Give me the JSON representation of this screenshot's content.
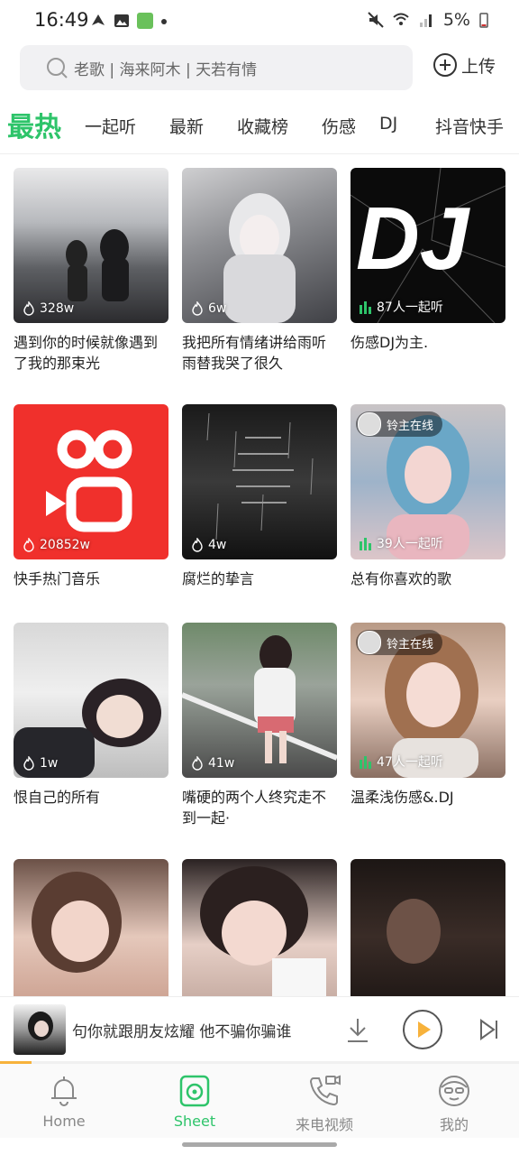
{
  "status_bar": {
    "time": "16:49",
    "battery": "5%"
  },
  "search": {
    "placeholder_text": "老歌 | 海来阿木 | 天若有情"
  },
  "upload": {
    "label": "上传"
  },
  "tabs": [
    {
      "label": "最热",
      "active": true
    },
    {
      "label": "一起听"
    },
    {
      "label": "最新"
    },
    {
      "label": "收藏榜"
    },
    {
      "label": "伤感"
    },
    {
      "label": "DJ"
    },
    {
      "label": "抖音快手"
    }
  ],
  "cards": [
    {
      "title": "遇到你的时候就像遇到了我的那束光",
      "count": "328w"
    },
    {
      "title": "我把所有情绪讲给雨听 雨替我哭了很久",
      "count": "6w"
    },
    {
      "title": "伤感DJ为主.",
      "count": "87人一起听",
      "dj_text": "DJ"
    },
    {
      "title": "快手热门音乐",
      "count": "20852w"
    },
    {
      "title": "腐烂的挚言",
      "count": "4w"
    },
    {
      "title": "总有你喜欢的歌",
      "count": "39人一起听",
      "badge": "铃主在线"
    },
    {
      "title": "恨自己的所有",
      "count": "1w"
    },
    {
      "title": "嘴硬的两个人终究走不到一起·",
      "count": "41w"
    },
    {
      "title": "温柔浅伤感&.DJ",
      "count": "47人一起听",
      "badge": "铃主在线"
    },
    {
      "title": "",
      "count": ""
    },
    {
      "title": "",
      "count": ""
    },
    {
      "title": "",
      "count": ""
    }
  ],
  "player": {
    "song": "句你就跟朋友炫耀 他不骗你骗谁",
    "progress": 0.06
  },
  "bottom_nav": [
    {
      "label": "Home",
      "icon": "bell-icon"
    },
    {
      "label": "Sheet",
      "icon": "music-sheet-icon",
      "active": true
    },
    {
      "label": "来电视频",
      "icon": "phone-video-icon"
    },
    {
      "label": "我的",
      "icon": "avatar-face-icon"
    }
  ],
  "colors": {
    "accent": "#2ec46a",
    "player_accent": "#f7b23b"
  }
}
